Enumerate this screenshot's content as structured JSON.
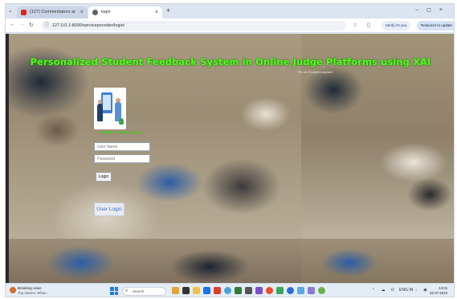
{
  "browser": {
    "tabs": [
      {
        "label": "(127) Commentators ar",
        "active": false,
        "favicon_color": "#e62117"
      },
      {
        "label": "login",
        "active": true,
        "favicon_color": "#5f6368"
      }
    ],
    "address": "127.0.0.1:8000/serviceprovider/login/",
    "profile_pill": "Verify it's you",
    "translate_pill": "Relaunch to update"
  },
  "page": {
    "title": "Personalized Student Feedback System in Online Judge Platforms using XAI",
    "subtitle": "Pic via Freepik/unsplash",
    "register_link": "Register / Create Account",
    "username_placeholder": "User Name",
    "password_placeholder": "Password",
    "login_label": "Login",
    "user_login_label": "User Login"
  },
  "taskbar": {
    "news_title": "Breaking news",
    "news_sub": "Top stories: What...",
    "search_placeholder": "Search",
    "language": "ENG IN",
    "time": "13:04",
    "date": "22-07-2023"
  },
  "colors": {
    "title_green": "#4dff1f",
    "accent_blue": "#3b6fd1",
    "taskbar_bg": "#e4ecf5"
  }
}
